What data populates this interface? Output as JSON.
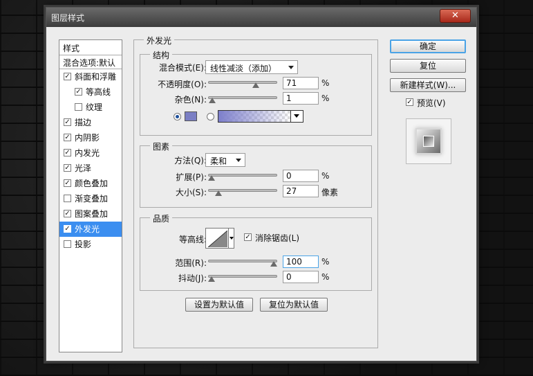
{
  "dialog": {
    "title": "图层样式",
    "close": "✕"
  },
  "stylelist": {
    "header": "样式",
    "blend": "混合选项:默认",
    "items": [
      {
        "label": "斜面和浮雕",
        "checked": true,
        "sub": false,
        "active": false
      },
      {
        "label": "等高线",
        "checked": true,
        "sub": true,
        "active": false
      },
      {
        "label": "纹理",
        "checked": false,
        "sub": true,
        "active": false
      },
      {
        "label": "描边",
        "checked": true,
        "sub": false,
        "active": false
      },
      {
        "label": "内阴影",
        "checked": true,
        "sub": false,
        "active": false
      },
      {
        "label": "内发光",
        "checked": true,
        "sub": false,
        "active": false
      },
      {
        "label": "光泽",
        "checked": true,
        "sub": false,
        "active": false
      },
      {
        "label": "颜色叠加",
        "checked": true,
        "sub": false,
        "active": false
      },
      {
        "label": "渐变叠加",
        "checked": false,
        "sub": false,
        "active": false
      },
      {
        "label": "图案叠加",
        "checked": true,
        "sub": false,
        "active": false
      },
      {
        "label": "外发光",
        "checked": true,
        "sub": false,
        "active": true
      },
      {
        "label": "投影",
        "checked": false,
        "sub": false,
        "active": false
      }
    ]
  },
  "panel": {
    "title": "外发光",
    "structure": {
      "title": "结构",
      "blend_label": "混合模式(E):",
      "blend_value": "线性减淡（添加）",
      "opacity_label": "不透明度(O):",
      "opacity_value": "71",
      "opacity_pct": 0.71,
      "noise_label": "杂色(N):",
      "noise_value": "1",
      "noise_pct": 0.01,
      "percent": "%",
      "color": "#7b7fc4"
    },
    "elements": {
      "title": "图素",
      "method_label": "方法(Q):",
      "method_value": "柔和",
      "spread_label": "扩展(P):",
      "spread_value": "0",
      "spread_pct": 0,
      "size_label": "大小(S):",
      "size_value": "27",
      "size_pct": 0.108,
      "percent": "%",
      "px": "像素"
    },
    "quality": {
      "title": "品质",
      "contour_label": "等高线:",
      "antialias_label": "消除锯齿(L)",
      "range_label": "范围(R):",
      "range_value": "100",
      "range_pct": 1.0,
      "jitter_label": "抖动(J):",
      "jitter_value": "0",
      "jitter_pct": 0,
      "percent": "%"
    },
    "set_default": "设置为默认值",
    "reset_default": "复位为默认值"
  },
  "right": {
    "ok": "确定",
    "reset": "复位",
    "new_style": "新建样式(W)...",
    "preview": "预览(V)"
  }
}
